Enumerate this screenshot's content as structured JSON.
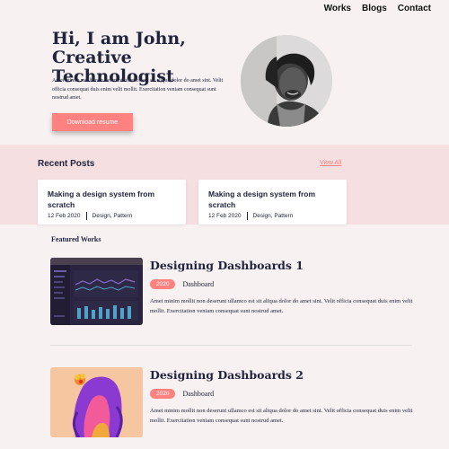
{
  "nav": [
    "Works",
    "Blogs",
    "Contact"
  ],
  "hero": {
    "title_line1": "Hi, I am John,",
    "title_line2": "Creative Technologist",
    "text": "Amet minim mollit non deserunt ullamco est sit aliqua dolor do amet sint. Velit officia consequat duis enim velit mollit. Exercitation veniam consequat sunt nostrud amet.",
    "button": "Download resume"
  },
  "recent": {
    "heading": "Recent Posts",
    "view_all": "View All",
    "posts": [
      {
        "title": "Making a design system from scratch",
        "date": "12 Feb 2020",
        "tags": "Design, Pattern"
      },
      {
        "title": "Making a design system from scratch",
        "date": "12 Feb 2020",
        "tags": "Design, Pattern"
      }
    ]
  },
  "featured": {
    "heading": "Featured Works",
    "items": [
      {
        "title": "Designing Dashboards 1",
        "year": "2020",
        "category": "Dashboard",
        "desc": "Amet minim mollit non deserunt ullamco est sit aliqua dolor do amet sint. Velit officia consequat duis enim velit mollit. Exercitation veniam consequat sunt nostrud amet."
      },
      {
        "title": "Designing Dashboards 2",
        "year": "2020",
        "category": "Dashboard",
        "desc": "Amet minim mollit non deserunt ullamco est sit aliqua dolor do amet sint. Velit officia consequat duis enim velit mollit. Exercitation veniam consequat sunt nostrud amet."
      }
    ]
  },
  "colors": {
    "accent": "#ff8280",
    "band": "#f5dfe0",
    "text": "#21243d",
    "bg": "#f7f1f1"
  }
}
